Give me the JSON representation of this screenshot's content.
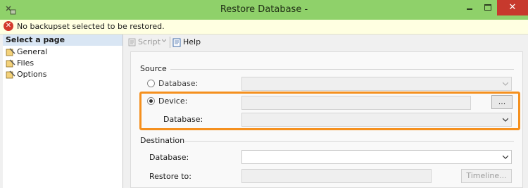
{
  "window": {
    "title": "Restore Database -",
    "close_glyph": "✕"
  },
  "error": {
    "icon": "error-icon",
    "glyph": "✕",
    "message": "No backupset selected to be restored."
  },
  "left_pane": {
    "header": "Select a page",
    "pages": [
      {
        "label": "General",
        "icon": "page-icon"
      },
      {
        "label": "Files",
        "icon": "page-icon"
      },
      {
        "label": "Options",
        "icon": "page-icon"
      }
    ]
  },
  "toolbar": {
    "script_label": "Script",
    "help_label": "Help"
  },
  "source": {
    "title": "Source",
    "database_radio_label": "Database:",
    "device_radio_label": "Device:",
    "selected": "device",
    "device_value": "",
    "browse_label": "...",
    "device_database_label": "Database:",
    "device_database_value": ""
  },
  "destination": {
    "title": "Destination",
    "database_label": "Database:",
    "database_value": "",
    "restore_to_label": "Restore to:",
    "restore_to_value": "",
    "timeline_label": "Timeline..."
  },
  "colors": {
    "titlebar": "#8fd16a",
    "highlight": "#f5901e",
    "close_button": "#c7392d"
  }
}
